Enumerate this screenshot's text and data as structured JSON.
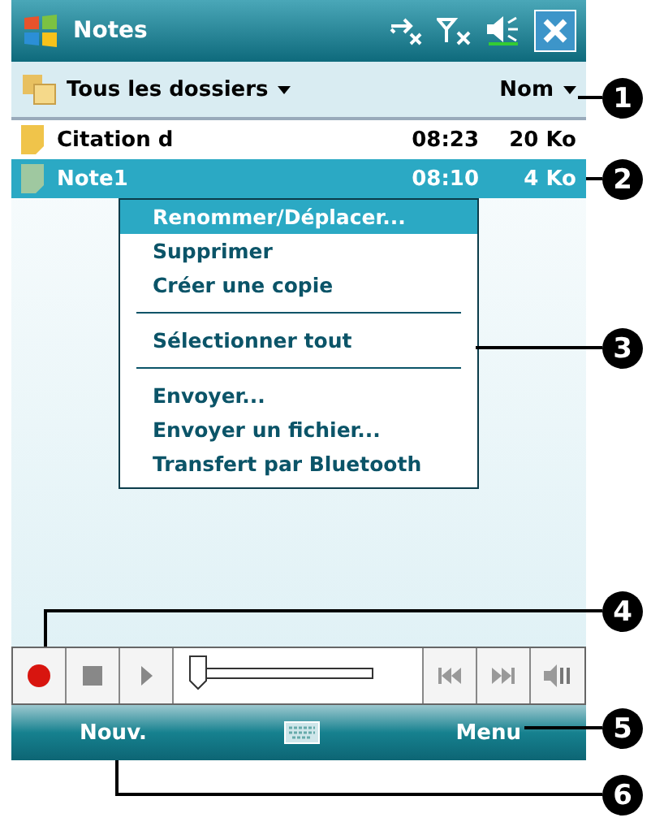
{
  "window": {
    "title": "Notes"
  },
  "header": {
    "folder": "Tous les dossiers",
    "sort": "Nom"
  },
  "rows": [
    {
      "name": "Citation d",
      "time": "08:23",
      "size": "20 Ko",
      "selected": false
    },
    {
      "name": "Note1",
      "time": "08:10",
      "size": "4 Ko",
      "selected": true
    }
  ],
  "menu": [
    {
      "kind": "item",
      "label": "Renommer/Déplacer...",
      "selected": true
    },
    {
      "kind": "item",
      "label": "Supprimer",
      "selected": false
    },
    {
      "kind": "item",
      "label": "Créer une copie",
      "selected": false
    },
    {
      "kind": "separator"
    },
    {
      "kind": "item",
      "label": "Sélectionner tout",
      "selected": false
    },
    {
      "kind": "separator"
    },
    {
      "kind": "item",
      "label": "Envoyer...",
      "selected": false
    },
    {
      "kind": "item",
      "label": "Envoyer un fichier...",
      "selected": false
    },
    {
      "kind": "item",
      "label": "Transfert par Bluetooth",
      "selected": false
    }
  ],
  "player": {
    "level": 0
  },
  "softkeys": {
    "left": "Nouv.",
    "right": "Menu"
  },
  "callouts": [
    "1",
    "2",
    "3",
    "4",
    "5",
    "6"
  ]
}
